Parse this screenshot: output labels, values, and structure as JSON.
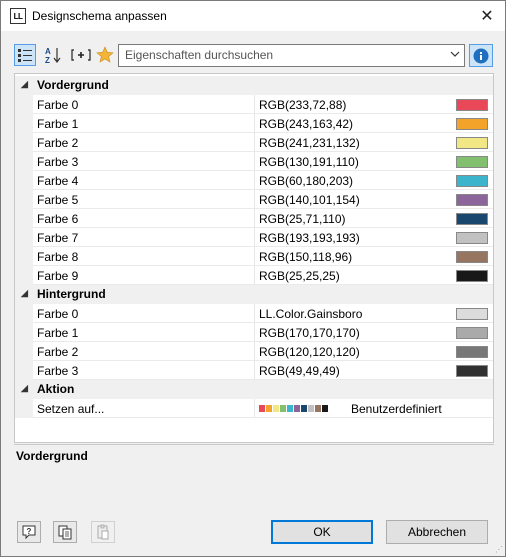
{
  "window": {
    "title": "Designschema anpassen",
    "icon_text": "LL",
    "close_glyph": "✕"
  },
  "toolbar": {
    "search_placeholder": "Eigenschaften durchsuchen"
  },
  "categories": [
    {
      "label": "Vordergrund",
      "items": [
        {
          "name": "Farbe 0",
          "value": "RGB(233,72,88)",
          "color": "#e94858"
        },
        {
          "name": "Farbe 1",
          "value": "RGB(243,163,42)",
          "color": "#f3a32a"
        },
        {
          "name": "Farbe 2",
          "value": "RGB(241,231,132)",
          "color": "#f1e784"
        },
        {
          "name": "Farbe 3",
          "value": "RGB(130,191,110)",
          "color": "#82bf6e"
        },
        {
          "name": "Farbe 4",
          "value": "RGB(60,180,203)",
          "color": "#3cb4cb"
        },
        {
          "name": "Farbe 5",
          "value": "RGB(140,101,154)",
          "color": "#8c659a"
        },
        {
          "name": "Farbe 6",
          "value": "RGB(25,71,110)",
          "color": "#19476e"
        },
        {
          "name": "Farbe 7",
          "value": "RGB(193,193,193)",
          "color": "#c1c1c1"
        },
        {
          "name": "Farbe 8",
          "value": "RGB(150,118,96)",
          "color": "#967660"
        },
        {
          "name": "Farbe 9",
          "value": "RGB(25,25,25)",
          "color": "#191919"
        }
      ]
    },
    {
      "label": "Hintergrund",
      "items": [
        {
          "name": "Farbe 0",
          "value": "LL.Color.Gainsboro",
          "color": "#dcdcdc"
        },
        {
          "name": "Farbe 1",
          "value": "RGB(170,170,170)",
          "color": "#aaaaaa"
        },
        {
          "name": "Farbe 2",
          "value": "RGB(120,120,120)",
          "color": "#787878"
        },
        {
          "name": "Farbe 3",
          "value": "RGB(49,49,49)",
          "color": "#313131"
        }
      ]
    },
    {
      "label": "Aktion",
      "items": [
        {
          "name": "Setzen auf...",
          "value": "Benutzerdefiniert"
        }
      ]
    }
  ],
  "description": {
    "title": "Vordergrund"
  },
  "buttons": {
    "ok": "OK",
    "cancel": "Abbrechen"
  }
}
